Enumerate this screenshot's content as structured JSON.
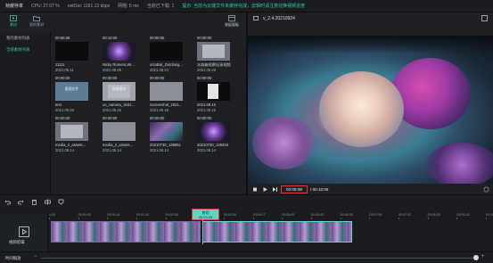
{
  "topbar": {
    "app_title": "帧缓存率",
    "cpu": "CPU: 27.07 %",
    "net_out": "netOut: 1191.13 kbps",
    "latency": "网络: 5 ms",
    "concurrency": "当前已下载: 1",
    "notice": "提示: 当前为云端文件未缓存完成，剪辑时请注意切换视频进度"
  },
  "left_panel": {
    "tabs": [
      {
        "label": "素材",
        "active": true,
        "icon": "media-icon"
      },
      {
        "label": "我的素材",
        "active": false,
        "icon": "folder-icon"
      }
    ],
    "collapse_label": "收起面板",
    "categories": [
      {
        "label": "我的素材列表",
        "active": false
      },
      {
        "label": "全部素材列表",
        "active": true
      }
    ],
    "cards": [
      {
        "duration": "00:00:36",
        "name": "11111",
        "date": "2021.06.11",
        "extra": "00:00:00",
        "thumb": "dark"
      },
      {
        "duration": "00:13:00",
        "name": "Nicky Romero,Wi...",
        "date": "2021.06.26",
        "extra": "00:00:00",
        "thumb": "plant"
      },
      {
        "duration": "00:00:00",
        "name": "octoBar_Discharg...",
        "date": "2021.06.24",
        "extra": "00:00:00",
        "thumb": "dark"
      },
      {
        "duration": "00:00:00",
        "name": "水族箱观察纪录视频",
        "date": "2021.06.26",
        "extra": "00:00:00",
        "thumb": "gray2"
      },
      {
        "duration": "00:00:00",
        "name": "test",
        "date": "2021.09.26",
        "extra": "00:00:00",
        "thumb": "blue",
        "overlay": "截图文件"
      },
      {
        "duration": "00:00:00",
        "name": "xo_camera_1631...",
        "date": "2021.09.15",
        "extra": "00:00:00",
        "thumb": "gray3",
        "overlay": "截图素材"
      },
      {
        "duration": "00:00:00",
        "name": "Screenshot_2021...",
        "date": "2021.09.15",
        "extra": "00:00:00",
        "thumb": "gray"
      },
      {
        "duration": "00:00:00",
        "name": "2021.09.15",
        "date": "2021.09.15",
        "extra": "00:00:00",
        "thumb": "dark2"
      },
      {
        "duration": "00:00:00",
        "name": "media_2_assets...",
        "date": "2021.09.14",
        "extra": "00:00:00",
        "thumb": "gray2"
      },
      {
        "duration": "00:00:00",
        "name": "media_2_assets...",
        "date": "2021.09.14",
        "extra": "00:00:00",
        "thumb": "gray"
      },
      {
        "duration": "00:00:00",
        "name": "20210730_135851",
        "date": "2021.09.14",
        "extra": "00:00:00",
        "thumb": "ocean"
      },
      {
        "duration": "00:00:00",
        "name": "20210730_135916",
        "date": "2021.09.14",
        "extra": "00:00:00",
        "thumb": "plant"
      }
    ]
  },
  "preview": {
    "title": "v_2.4.20210924",
    "current_time": "00:05:08",
    "total_time": "00:10:06"
  },
  "timeline": {
    "track_label": "视频剪辑",
    "cut_label": "剪切",
    "cut_time": "00:03:43",
    "ruler": [
      "0:00",
      "00:00:05",
      "00:00:16",
      "00:01:30",
      "00:02:08",
      "00:02:51",
      "00:03:34",
      "00:04:17",
      "00:05:00",
      "00:05:43",
      "00:06:26",
      "00:07:09",
      "00:07:52",
      "00:08:35",
      "00:09:18",
      "00:10:01"
    ]
  },
  "zoombar": {
    "label": "时间缩放"
  },
  "colors": {
    "accent": "#33c9a4",
    "highlight_border": "#e03a3a",
    "clip_selected": "#5fd6c2"
  }
}
